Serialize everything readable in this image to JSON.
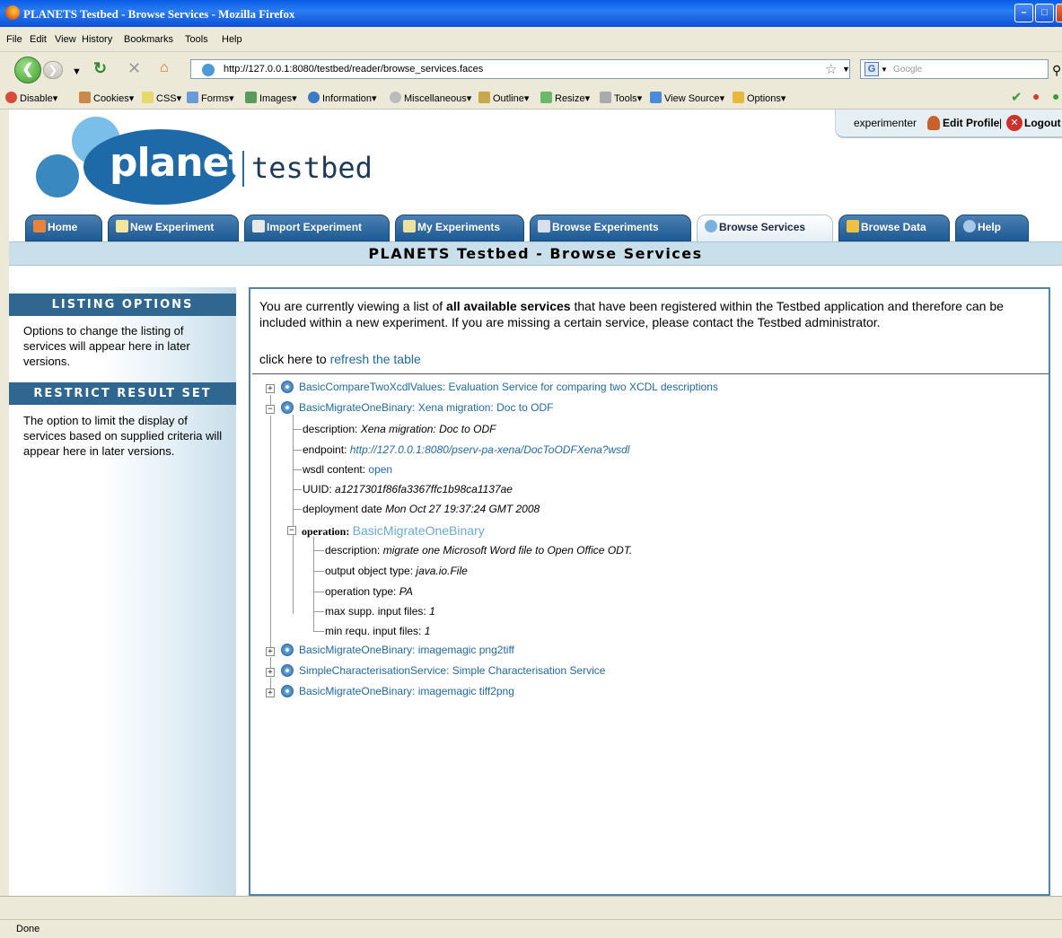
{
  "window": {
    "title": "PLANETS Testbed - Browse Services - Mozilla Firefox"
  },
  "menu": [
    "File",
    "Edit",
    "View",
    "History",
    "Bookmarks",
    "Tools",
    "Help"
  ],
  "nav": {
    "url": "http://127.0.0.1:8080/testbed/reader/browse_services.faces",
    "search_placeholder": "Google"
  },
  "devbar": {
    "items": [
      "Disable",
      "Cookies",
      "CSS",
      "Forms",
      "Images",
      "Information",
      "Miscellaneous",
      "Outline",
      "Resize",
      "Tools",
      "View Source",
      "Options"
    ]
  },
  "user": {
    "name": "experimenter",
    "edit_profile": "Edit Profile",
    "separator": "|",
    "logout": "Logout"
  },
  "logo": {
    "brand": "planets",
    "product": "testbed"
  },
  "tabs": [
    {
      "label": "Home",
      "active": false
    },
    {
      "label": "New Experiment",
      "active": false
    },
    {
      "label": "Import Experiment",
      "active": false
    },
    {
      "label": "My Experiments",
      "active": false
    },
    {
      "label": "Browse Experiments",
      "active": false
    },
    {
      "label": "Browse Services",
      "active": true
    },
    {
      "label": "Browse Data",
      "active": false
    },
    {
      "label": "Help",
      "active": false
    }
  ],
  "page_title": "PLANETS Testbed - Browse Services",
  "sidebar": {
    "listing_heading": "LISTING OPTIONS",
    "listing_text": "Options to change the listing of services will appear here in later versions.",
    "restrict_heading": "RESTRICT RESULT SET",
    "restrict_text": "The option to limit the display of services based on supplied criteria will appear here in later versions."
  },
  "main": {
    "intro_before": "You are currently viewing a list of ",
    "intro_bold": "all available services",
    "intro_after": " that have been registered within the Testbed application and therefore can be included within a new experiment. If you are missing a certain service, please contact the Testbed administrator.",
    "refresh_prefix": "click here to ",
    "refresh_link": "refresh the table"
  },
  "tree": {
    "services": [
      "BasicCompareTwoXcdlValues: Evaluation Service for comparing two XCDL descriptions",
      "BasicMigrateOneBinary: Xena migration: Doc to ODF",
      "BasicMigrateOneBinary: imagemagic png2tiff",
      "SimpleCharacterisationService: Simple Characterisation Service",
      "BasicMigrateOneBinary: imagemagic tiff2png"
    ],
    "expanded_details": {
      "description_label": "description:",
      "description_value": "Xena migration: Doc to ODF",
      "endpoint_label": "endpoint:",
      "endpoint_value": "http://127.0.0.1:8080/pserv-pa-xena/DocToODFXena?wsdl",
      "wsdl_label": "wsdl content:",
      "wsdl_value": "open",
      "uuid_label": "UUID:",
      "uuid_value": "a1217301f86fa3367ffc1b98ca1137ae",
      "deploy_label": "deployment date",
      "deploy_value": "Mon Oct 27 19:37:24 GMT 2008",
      "operation_label": "operation:",
      "operation_value": "BasicMigrateOneBinary",
      "op_description_label": "description:",
      "op_description_value": "migrate one Microsoft Word file to Open Office ODT.",
      "output_type_label": "output object type:",
      "output_type_value": "java.io.File",
      "op_type_label": "operation type:",
      "op_type_value": "PA",
      "max_files_label": "max supp. input files:",
      "max_files_value": "1",
      "min_files_label": "min requ. input files:",
      "min_files_value": "1"
    }
  },
  "status": "Done",
  "colors": {
    "tab_blue": "#2a6aa0",
    "sidebar_heading": "#2f6791",
    "link": "#1e6aa8",
    "band": "#c9e0ec"
  }
}
